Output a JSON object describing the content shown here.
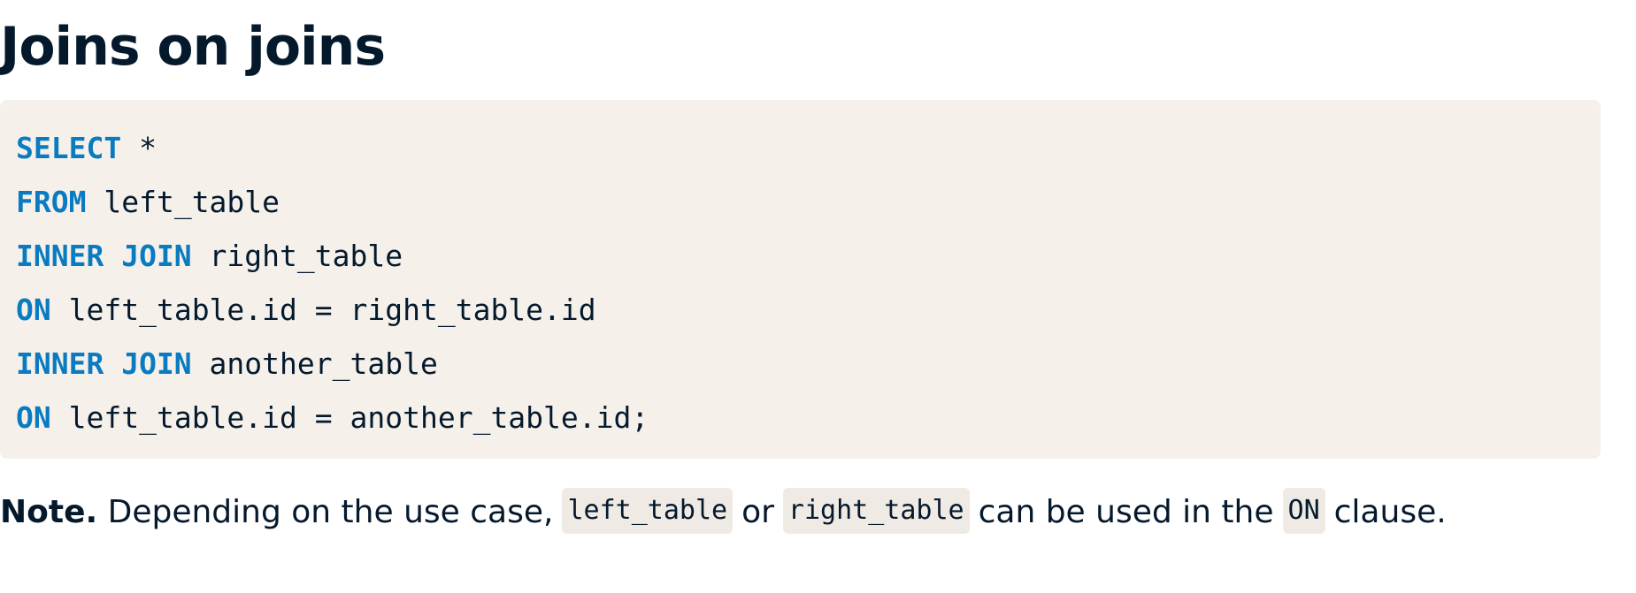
{
  "heading": {
    "title": "Joins on joins"
  },
  "code": {
    "lines": [
      {
        "keyword": "SELECT",
        "rest": " *"
      },
      {
        "keyword": "FROM",
        "rest": " left_table"
      },
      {
        "keyword": "INNER JOIN",
        "rest": " right_table"
      },
      {
        "keyword": "ON",
        "rest": " left_table.id = right_table.id"
      },
      {
        "keyword": "INNER JOIN",
        "rest": " another_table"
      },
      {
        "keyword": "ON",
        "rest": " left_table.id = another_table.id;"
      }
    ]
  },
  "note": {
    "label": "Note.",
    "text_1": " Depending on the use case,",
    "code_1": "left_table",
    "text_2": "or",
    "code_2": "right_table",
    "text_3": "can be used in the",
    "code_3": "ON",
    "text_4": "clause."
  },
  "colors": {
    "text": "#05192d",
    "keyword": "#0b7bc1",
    "code_background": "#f5f1ea",
    "inline_code_background": "#efebe4"
  }
}
